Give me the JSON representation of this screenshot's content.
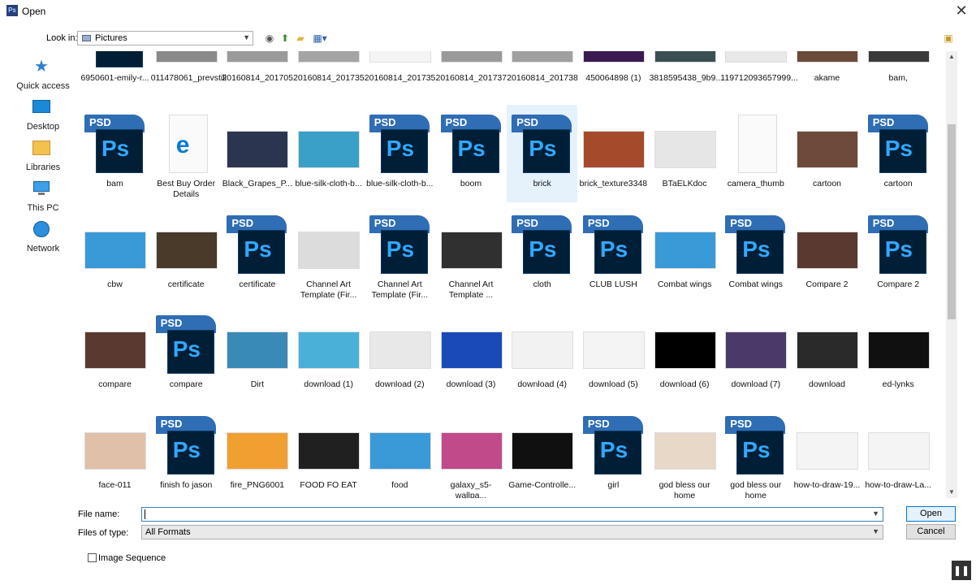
{
  "window": {
    "title": "Open",
    "app_icon": "Ps",
    "close": "✕"
  },
  "toolbar": {
    "look_in_label": "Look in:",
    "look_in_value": "Pictures"
  },
  "places": [
    {
      "label": "Quick access",
      "icon": "star-icon"
    },
    {
      "label": "Desktop",
      "icon": "desktop-icon"
    },
    {
      "label": "Libraries",
      "icon": "libraries-icon"
    },
    {
      "label": "This PC",
      "icon": "pc-icon"
    },
    {
      "label": "Network",
      "icon": "network-icon"
    }
  ],
  "rows": [
    [
      {
        "name": "6950601-emily-r...",
        "kind": "psd"
      },
      {
        "name": "011478061_prevstill",
        "kind": "img",
        "color": "#8a8a8a"
      },
      {
        "name": "20160814_201705",
        "kind": "img",
        "color": "#9a9a9a"
      },
      {
        "name": "20160814_201735",
        "kind": "img",
        "color": "#a4a4a4"
      },
      {
        "name": "20160814_201735",
        "kind": "img",
        "color": "#f4f4f4"
      },
      {
        "name": "20160814_201737",
        "kind": "img",
        "color": "#9a9a9a"
      },
      {
        "name": "20160814_201738",
        "kind": "img",
        "color": "#a0a0a0"
      },
      {
        "name": "450064898 (1)",
        "kind": "img",
        "color": "#3b1a52"
      },
      {
        "name": "3818595438_9b9...",
        "kind": "img",
        "color": "#3a4f52"
      },
      {
        "name": "119712093657999...",
        "kind": "img",
        "color": "#e8e8e8"
      },
      {
        "name": "akame",
        "kind": "img",
        "color": "#6b4a3a"
      },
      {
        "name": "bam,",
        "kind": "img",
        "color": "#3a3a3a"
      }
    ],
    [
      {
        "name": "bam",
        "kind": "psd"
      },
      {
        "name": "Best Buy Order Details",
        "kind": "edge"
      },
      {
        "name": "Black_Grapes_P...",
        "kind": "img",
        "color": "#2c3550"
      },
      {
        "name": "blue-silk-cloth-b...",
        "kind": "img",
        "color": "#3aa0c8"
      },
      {
        "name": "blue-silk-cloth-b...",
        "kind": "psd"
      },
      {
        "name": "boom",
        "kind": "psd"
      },
      {
        "name": "brick",
        "kind": "psd",
        "selected": true
      },
      {
        "name": "brick_texture3348",
        "kind": "img",
        "color": "#a64a2c"
      },
      {
        "name": "BTaELKdoc",
        "kind": "img",
        "color": "#e6e6e6"
      },
      {
        "name": "camera_thumb",
        "kind": "blank"
      },
      {
        "name": "cartoon",
        "kind": "img",
        "color": "#6e4a3a"
      },
      {
        "name": "cartoon",
        "kind": "psd"
      }
    ],
    [
      {
        "name": "cbw",
        "kind": "img",
        "color": "#3a9ad8"
      },
      {
        "name": "certificate",
        "kind": "img",
        "color": "#4a3a2a"
      },
      {
        "name": "certificate",
        "kind": "psd"
      },
      {
        "name": "Channel Art Template (Fir...",
        "kind": "img",
        "color": "#dcdcdc"
      },
      {
        "name": "Channel Art Template (Fir...",
        "kind": "psd"
      },
      {
        "name": "Channel Art Template ...",
        "kind": "img",
        "color": "#303030"
      },
      {
        "name": "cloth",
        "kind": "psd"
      },
      {
        "name": "CLUB LUSH",
        "kind": "psd"
      },
      {
        "name": "Combat wings",
        "kind": "img",
        "color": "#3a9ad8"
      },
      {
        "name": "Combat wings",
        "kind": "psd"
      },
      {
        "name": "Compare 2",
        "kind": "img",
        "color": "#5a3a30"
      },
      {
        "name": "Compare 2",
        "kind": "psd"
      }
    ],
    [
      {
        "name": "compare",
        "kind": "img",
        "color": "#5a3a30"
      },
      {
        "name": "compare",
        "kind": "psd"
      },
      {
        "name": "Dirt",
        "kind": "img",
        "color": "#3a8ab8"
      },
      {
        "name": "download (1)",
        "kind": "img",
        "color": "#4ab0d8"
      },
      {
        "name": "download (2)",
        "kind": "img",
        "color": "#e8e8e8"
      },
      {
        "name": "download (3)",
        "kind": "img",
        "color": "#1a4ab8"
      },
      {
        "name": "download (4)",
        "kind": "img",
        "color": "#f2f2f2"
      },
      {
        "name": "download (5)",
        "kind": "img",
        "color": "#f4f4f4"
      },
      {
        "name": "download (6)",
        "kind": "img",
        "color": "#000000"
      },
      {
        "name": "download (7)",
        "kind": "img",
        "color": "#4a3a6a"
      },
      {
        "name": "download",
        "kind": "img",
        "color": "#2a2a2a"
      },
      {
        "name": "ed-lynks",
        "kind": "img",
        "color": "#101010"
      }
    ],
    [
      {
        "name": "face-011",
        "kind": "img",
        "color": "#e0c0a8"
      },
      {
        "name": "finish fo jason",
        "kind": "psd"
      },
      {
        "name": "fire_PNG6001",
        "kind": "img",
        "color": "#f0a030"
      },
      {
        "name": "FOOD FO EAT",
        "kind": "img",
        "color": "#202020"
      },
      {
        "name": "food",
        "kind": "img",
        "color": "#3a9ad8"
      },
      {
        "name": "galaxy_s5-wallpa...",
        "kind": "img",
        "color": "#c04a8a"
      },
      {
        "name": "Game-Controlle...",
        "kind": "img",
        "color": "#101010"
      },
      {
        "name": "girl",
        "kind": "psd"
      },
      {
        "name": "god bless our home",
        "kind": "img",
        "color": "#e8d8c8"
      },
      {
        "name": "god bless our home",
        "kind": "psd"
      },
      {
        "name": "how-to-draw-19...",
        "kind": "img",
        "color": "#f4f4f4"
      },
      {
        "name": "how-to-draw-La...",
        "kind": "img",
        "color": "#f4f4f4"
      }
    ]
  ],
  "bottom": {
    "file_name_label": "File name:",
    "file_name_value": "",
    "files_of_type_label": "Files of type:",
    "files_of_type_value": "All Formats",
    "open_label": "Open",
    "cancel_label": "Cancel",
    "image_sequence_label": "Image Sequence"
  }
}
